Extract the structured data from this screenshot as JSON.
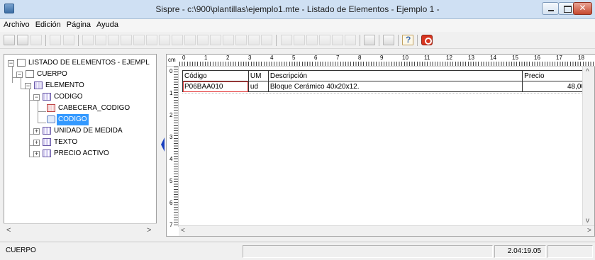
{
  "window": {
    "title": "Sispre - c:\\900\\plantillas\\ejemplo1.mte - Listado de Elementos - Ejemplo 1 -",
    "close_label": "✕"
  },
  "menu": [
    "Archivo",
    "Edición",
    "Página",
    "Ayuda"
  ],
  "tree": {
    "root": "LISTADO DE ELEMENTOS - EJEMPL",
    "cuerpo": "CUERPO",
    "elemento": "ELEMENTO",
    "codigo": "CODIGO",
    "cabecera_codigo": "CABECERA_CODIGO",
    "codigo_field": "CODIGO",
    "unidad": "UNIDAD DE MEDIDA",
    "texto": "TEXTO",
    "precio": "PRECIO ACTIVO",
    "expand_minus": "−",
    "expand_plus": "+"
  },
  "ruler": {
    "unit": "cm",
    "h_ticks": [
      "0",
      "1",
      "2",
      "3",
      "4",
      "5",
      "6",
      "7",
      "8",
      "9",
      "10",
      "11",
      "12",
      "13",
      "14",
      "15",
      "16",
      "17",
      "18"
    ],
    "v_ticks": [
      "0",
      "1",
      "2",
      "3",
      "4",
      "5",
      "6",
      "7"
    ]
  },
  "document": {
    "headers": [
      "Código",
      "UM",
      "Descripción",
      "Precio"
    ],
    "row": [
      "P06BAA010",
      "ud",
      "Bloque Cerámico 40x20x12.",
      "48,00"
    ]
  },
  "scroll": {
    "left": "<",
    "right": ">",
    "up": "^",
    "down": "v"
  },
  "status": {
    "pane1": "CUERPO",
    "pane2": "",
    "time": "2.04:19.05",
    "pane4": ""
  }
}
